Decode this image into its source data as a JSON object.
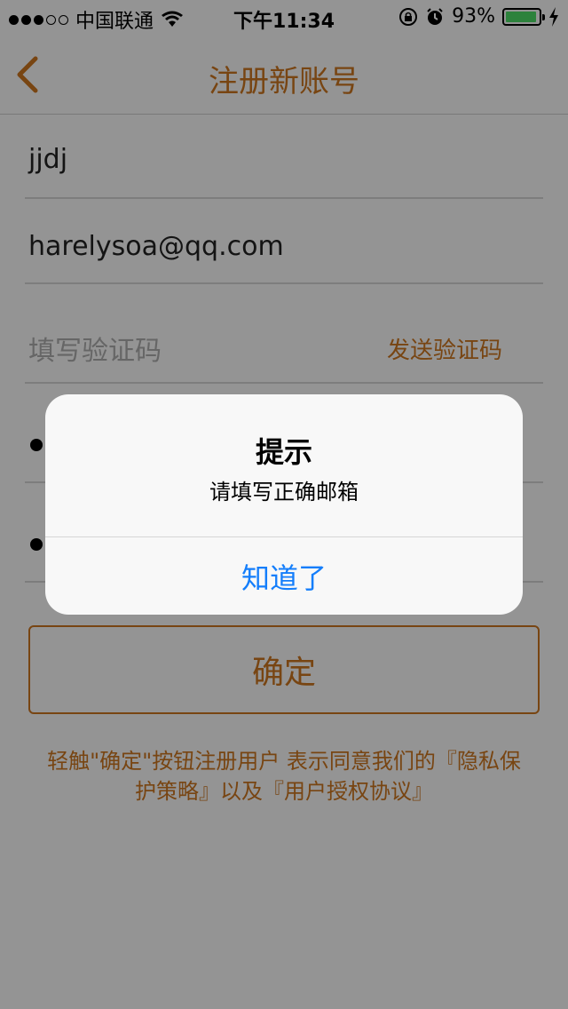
{
  "status_bar": {
    "carrier": "中国联通",
    "time": "下午11:34",
    "battery": "93%",
    "battery_level": 0.93,
    "signal_icons": [
      "signal-dots-icon",
      "wifi-icon",
      "rotation-lock-icon",
      "alarm-icon",
      "battery-icon",
      "charging-icon"
    ]
  },
  "nav": {
    "title": "注册新账号",
    "back_icon": "chevron-left-icon"
  },
  "form": {
    "username_value": "jjdj",
    "email_value": "harelysoa@qq.com",
    "code_placeholder": "填写验证码",
    "send_code_label": "发送验证码",
    "confirm_label": "确定",
    "agreement_line1": "轻触\"确定\"按钮注册用户 表示同意我们的『隐私保",
    "agreement_line2": "护策略』以及『用户授权协议』"
  },
  "alert": {
    "title": "提示",
    "message": "请填写正确邮箱",
    "button": "知道了"
  },
  "colors": {
    "accent": "#c8731f",
    "alert_button": "#147efb",
    "battery_fill": "#4cd964"
  }
}
